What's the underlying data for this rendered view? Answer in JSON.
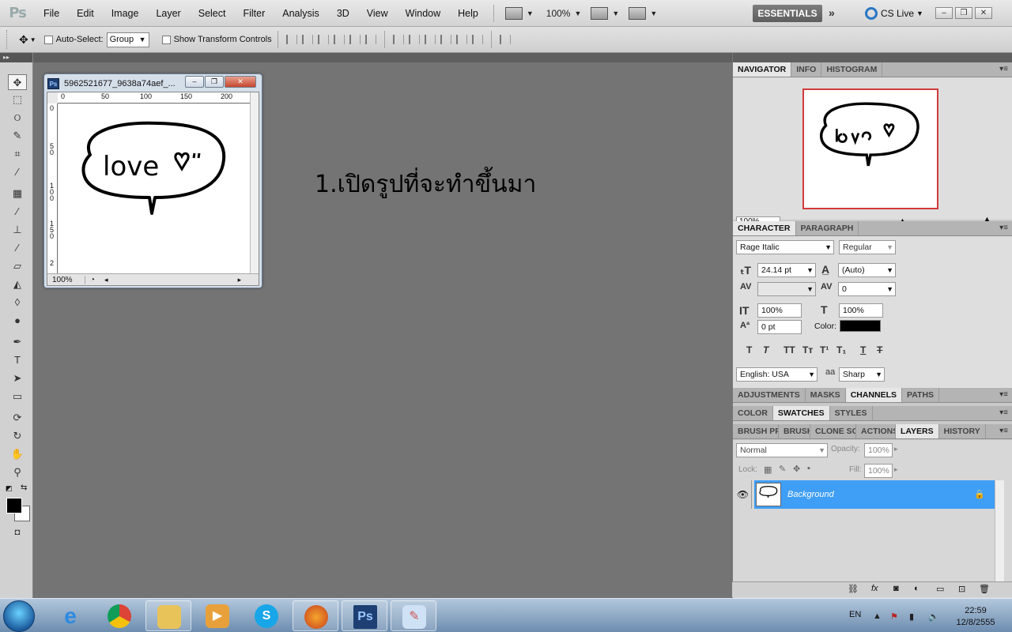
{
  "app": {
    "logo": "Ps",
    "menu": [
      "File",
      "Edit",
      "Image",
      "Layer",
      "Select",
      "Filter",
      "Analysis",
      "3D",
      "View",
      "Window",
      "Help"
    ],
    "zoom": "100%",
    "workspace": "ESSENTIALS",
    "more_workspaces": "»",
    "cs_live": "CS Live"
  },
  "options_bar": {
    "auto_select_label": "Auto-Select:",
    "auto_select_value": "Group",
    "show_transform_label": "Show Transform Controls"
  },
  "document": {
    "title": "5962521677_9638a74aef_...",
    "zoom": "100%",
    "ruler_top": [
      "0",
      "50",
      "100",
      "150",
      "200"
    ],
    "ruler_left": [
      "0",
      "5\n0",
      "1\n0\n0",
      "1\n5\n0",
      "2"
    ],
    "image_text": "love"
  },
  "caption": "1.เปิดรูปที่จะทำขึ้นมา",
  "navigator": {
    "tabs": [
      "NAVIGATOR",
      "INFO",
      "HISTOGRAM"
    ],
    "zoom": "100%"
  },
  "character": {
    "tabs": [
      "CHARACTER",
      "PARAGRAPH"
    ],
    "font_family": "Rage Italic",
    "font_style": "Regular",
    "font_size": "24.14 pt",
    "leading": "(Auto)",
    "kerning": "",
    "tracking": "0",
    "vertical_scale": "100%",
    "horizontal_scale": "100%",
    "baseline_shift": "0 pt",
    "color_label": "Color:",
    "color_value": "#000000",
    "language": "English: USA",
    "antialias_icon": "aa",
    "antialias": "Sharp"
  },
  "panels_row1": [
    "ADJUSTMENTS",
    "MASKS",
    "CHANNELS",
    "PATHS"
  ],
  "panels_row2": [
    "COLOR",
    "SWATCHES",
    "STYLES"
  ],
  "panels_row3": [
    "BRUSH PR",
    "BRUSH",
    "CLONE SOU",
    "ACTIONS",
    "LAYERS",
    "HISTORY"
  ],
  "layers": {
    "blend_mode": "Normal",
    "opacity_label": "Opacity:",
    "opacity": "100%",
    "lock_label": "Lock:",
    "fill_label": "Fill:",
    "fill": "100%",
    "layer_name": "Background"
  },
  "taskbar": {
    "lang": "EN",
    "time": "22:59",
    "date": "12/8/2555"
  },
  "colors": {
    "accent_selection": "#3f9ef5",
    "workspace_bg": "#747474"
  }
}
